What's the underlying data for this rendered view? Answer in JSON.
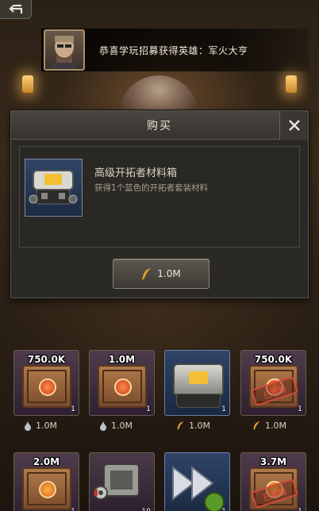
{
  "notification": {
    "text": "恭喜学玩招募获得英雄：军火大亨"
  },
  "dialog": {
    "title": "购买",
    "item": {
      "name": "高级开拓者材料箱",
      "description": "获得1个蓝色的开拓者套装材料",
      "icon": "silver-chest-icon"
    },
    "buy_button": {
      "price": "1.0M",
      "currency_icon": "feather-icon"
    }
  },
  "shop": {
    "row1": [
      {
        "badge": "750.0K",
        "qty": "1",
        "cost": "1.0M",
        "currency_icon": "water-drop-icon",
        "sold": ""
      },
      {
        "badge": "1.0M",
        "qty": "1",
        "cost": "1.0M",
        "currency_icon": "water-drop-icon",
        "sold": ""
      },
      {
        "badge": "",
        "qty": "1",
        "cost": "1.0M",
        "currency_icon": "feather-icon",
        "sold": ""
      },
      {
        "badge": "750.0K",
        "qty": "1",
        "cost": "1.0M",
        "currency_icon": "feather-icon",
        "sold": "已售罄"
      }
    ],
    "row2": [
      {
        "badge": "2.0M",
        "qty": "1"
      },
      {
        "badge": "",
        "qty": "10"
      },
      {
        "badge": "",
        "qty": "1"
      },
      {
        "badge": "3.7M",
        "qty": "1",
        "sold": "已售罄"
      }
    ]
  },
  "colors": {
    "sold_stamp": "#e85a48",
    "feather": "#f0a030",
    "water_drop": "#b8c4d0"
  }
}
